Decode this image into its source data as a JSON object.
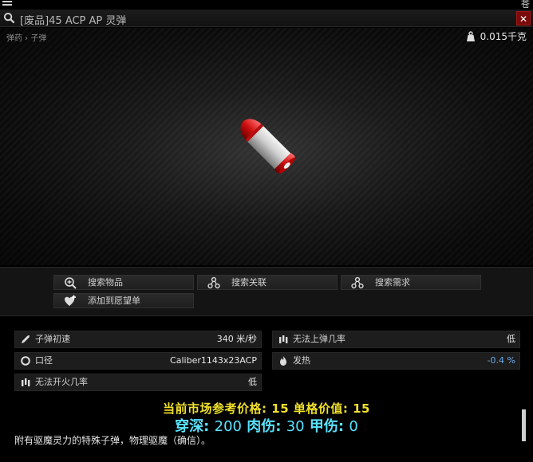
{
  "window": {
    "title": "[废品]45 ACP AP 灵弹",
    "corner_glyph": "苍",
    "close_glyph": "✕"
  },
  "viewer": {
    "breadcrumb": "弹药 › 子弹",
    "weight": "0.015千克"
  },
  "actions": {
    "search_item": "搜索物品",
    "search_related": "搜索关联",
    "search_requirements": "搜索需求",
    "add_wishlist": "添加到愿望单"
  },
  "stats": {
    "muzzle_velocity": {
      "label": "子弹初速",
      "value": "340 米/秒"
    },
    "caliber": {
      "label": "口径",
      "value": "Caliber1143x23ACP"
    },
    "misfire": {
      "label": "无法开火几率",
      "value": "低"
    },
    "feed_failure": {
      "label": "无法上弹几率",
      "value": "低"
    },
    "heat": {
      "label": "发热",
      "value": "-0.4 %"
    }
  },
  "info": {
    "price_line": "当前市场参考价格: 15 单格价值: 15",
    "pen_label": "穿深: ",
    "pen_value": "200",
    "flesh_label": " 肉伤: ",
    "flesh_value": "30",
    "armor_label": " 甲伤: ",
    "armor_value": "0",
    "description": "附有驱魔灵力的特殊子弹，物理驱魔（确信）。"
  },
  "colors": {
    "price_yellow": "#f1e12a",
    "pen_cyan": "#59e3ff",
    "heat_blue": "#6aa8e6",
    "close_red": "#7a0b0b"
  }
}
